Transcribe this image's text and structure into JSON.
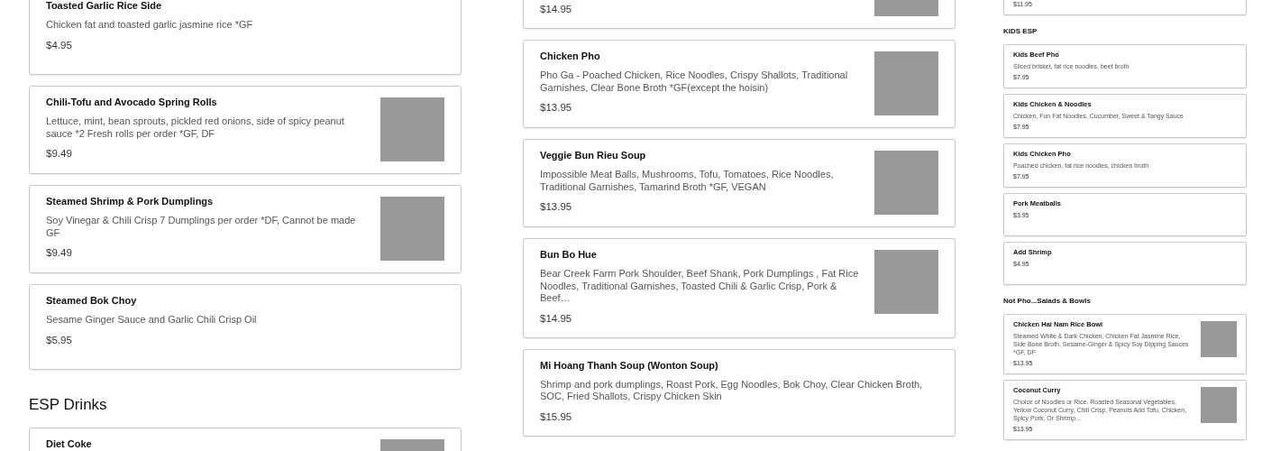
{
  "columns": [
    {
      "compact": false,
      "blocks": [
        {
          "kind": "item",
          "title": "Toasted Garlic Rice Side",
          "description": "Chicken fat and toasted garlic jasmine rice *GF",
          "price": "$4.95",
          "image": false
        },
        {
          "kind": "item",
          "title": "Chili-Tofu and Avocado Spring Rolls",
          "description": "Lettuce, mint, bean sprouts, pickled red onions, side of spicy peanut sauce *2 Fresh rolls per order *GF, DF",
          "price": "$9.49",
          "image": true
        },
        {
          "kind": "item",
          "title": "Steamed Shrimp & Pork Dumplings",
          "description": "Soy Vinegar & Chili Crisp 7 Dumplings per order *DF, Cannot be made GF",
          "price": "$9.49",
          "image": true
        },
        {
          "kind": "item",
          "title": "Steamed Bok Choy",
          "description": "Sesame Ginger Sauce and Garlic Chili Crisp Oil",
          "price": "$5.95",
          "image": false
        },
        {
          "kind": "heading",
          "title": "ESP Drinks"
        },
        {
          "kind": "item",
          "title": "Diet Coke",
          "image": true
        }
      ]
    },
    {
      "compact": false,
      "blocks": [
        {
          "kind": "item",
          "price": "$14.95",
          "image": true
        },
        {
          "kind": "item",
          "title": "Chicken Pho",
          "description": "Pho Ga - Poached Chicken, Rice Noodles, Crispy Shallots, Traditional Garnishes, Clear Bone Broth *GF(except the hoisin)",
          "price": "$13.95",
          "image": true
        },
        {
          "kind": "item",
          "title": "Veggie Bun Rieu Soup",
          "description": "Impossible Meat Balls, Mushrooms, Tofu, Tomatoes, Rice Noodles, Traditional Garnishes, Tamarind Broth *GF, VEGAN",
          "price": "$13.95",
          "image": true
        },
        {
          "kind": "item",
          "title": "Bun Bo Hue",
          "description": "Bear Creek Farm Pork Shoulder, Beef Shank, Pork Dumplings , Fat Rice Noodles, Traditional Garnishes, Toasted Chili & Garlic Crisp, Pork & Beef…",
          "price": "$14.95",
          "image": true
        },
        {
          "kind": "item",
          "title": "Mi Hoang Thanh Soup (Wonton Soup)",
          "description": "Shrimp and pork dumplings, Roast Pork, Egg Noodles, Bok Choy, Clear Chicken Broth, SOC, Fried Shallots, Crispy Chicken Skin",
          "price": "$15.95",
          "image": false
        }
      ]
    },
    {
      "compact": true,
      "blocks": [
        {
          "kind": "item",
          "price": "$11.95",
          "image": false
        },
        {
          "kind": "heading",
          "title": "KIDS ESP"
        },
        {
          "kind": "item",
          "title": "Kids Beef Pho",
          "description": "Sliced brisket, fat rice noodles, beef broth",
          "price": "$7.95",
          "image": false
        },
        {
          "kind": "item",
          "title": "Kids Chicken & Noodles",
          "description": "Chicken, Fun Fat Noodles, Cucumber, Sweet & Tangy Sauce",
          "price": "$7.95",
          "image": false
        },
        {
          "kind": "item",
          "title": "Kids Chicken Pho",
          "description": "Poached chicken, fat rice noodles, chicken broth",
          "price": "$7.95",
          "image": false
        },
        {
          "kind": "item",
          "title": "Pork Meatballs",
          "price": "$3.95",
          "image": false
        },
        {
          "kind": "item",
          "title": "Add Shrimp",
          "price": "$4.95",
          "image": false
        },
        {
          "kind": "heading",
          "title": "Not Pho...Salads & Bowls"
        },
        {
          "kind": "item",
          "title": "Chicken Hai Nam Rice Bowl",
          "description": "Steamed White & Dark Chicken, Chicken Fat Jasmine Rice, Side Bone Broth, Sesame-Ginger & Spicy Soy Dipping Sauces *GF, DF",
          "price": "$13.95",
          "image": true
        },
        {
          "kind": "item",
          "title": "Coconut Curry",
          "description": "Choice of Noodles or Rice. Roasted Seasonal Vegetables, Yellow Coconut Curry, Chili Crisp, Peanuts Add Tofu, Chicken, Spicy Pork, Or Shrimp...",
          "price": "$13.95",
          "image": true
        }
      ]
    }
  ]
}
